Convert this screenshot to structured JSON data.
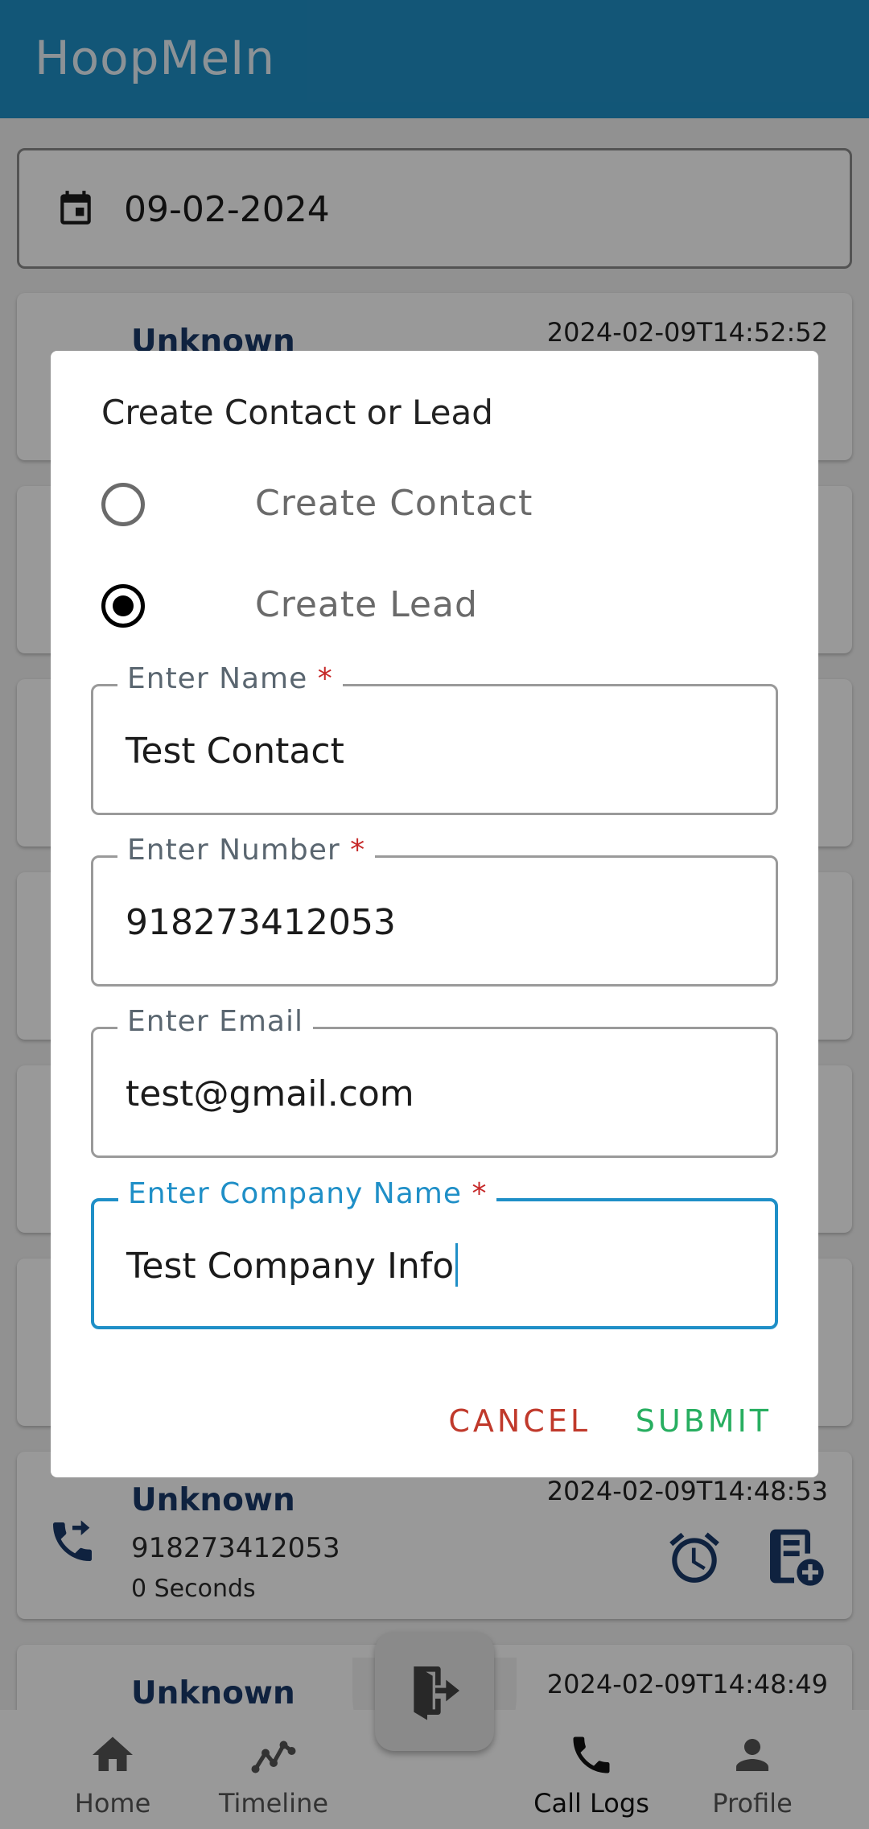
{
  "app": {
    "title": "HoopMeIn"
  },
  "date_filter": {
    "value": "09-02-2024",
    "icon": "calendar-icon"
  },
  "call_logs": [
    {
      "name": "Unknown",
      "number": "",
      "duration": "",
      "timestamp": "2024-02-09T14:52:52"
    },
    {
      "name": "Unknown",
      "number": "918273412053",
      "duration": "0 Seconds",
      "timestamp": "2024-02-09T14:48:53"
    },
    {
      "name": "Unknown",
      "number": "",
      "duration": "",
      "timestamp": "2024-02-09T14:48:49"
    }
  ],
  "bottom_nav": {
    "items": [
      {
        "label": "Home",
        "icon": "home-icon"
      },
      {
        "label": "Timeline",
        "icon": "timeline-icon"
      },
      {
        "label": "Call Logs",
        "icon": "phone-icon",
        "active": true
      },
      {
        "label": "Profile",
        "icon": "person-icon"
      }
    ],
    "fab_icon": "logout-icon"
  },
  "dialog": {
    "title": "Create Contact or Lead",
    "options": [
      {
        "label": "Create Contact",
        "selected": false
      },
      {
        "label": "Create Lead",
        "selected": true
      }
    ],
    "fields": {
      "name": {
        "label": "Enter Name",
        "required_mark": "*",
        "value": "Test Contact"
      },
      "number": {
        "label": "Enter Number",
        "required_mark": "*",
        "value": "918273412053"
      },
      "email": {
        "label": "Enter Email",
        "value": "test@gmail.com"
      },
      "company": {
        "label": "Enter Company Name",
        "required_mark": "*",
        "value": "Test Company Info"
      }
    },
    "cancel_label": "CANCEL",
    "submit_label": "SUBMIT"
  },
  "colors": {
    "primary": "#1f8fc7",
    "cancel": "#c0392b",
    "submit": "#27ae60",
    "required": "#c62828"
  }
}
